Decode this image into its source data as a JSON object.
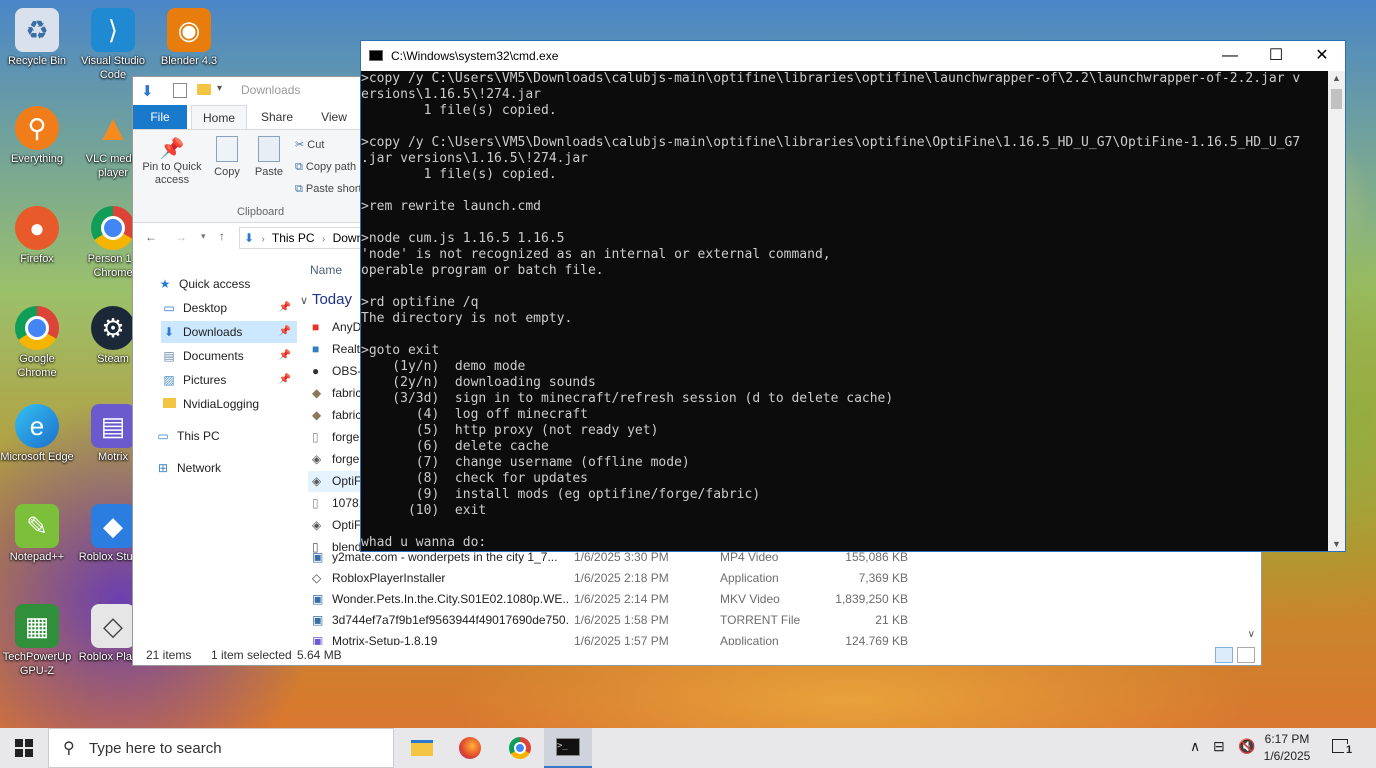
{
  "desktop": {
    "icons": [
      {
        "label": "Recycle Bin",
        "icon": "recycle-bin-icon",
        "color": "#cfd8e3"
      },
      {
        "label": "Visual Studio Code",
        "icon": "vscode-icon",
        "color": "#1f8ad2"
      },
      {
        "label": "Blender 4.3",
        "icon": "blender-icon",
        "color": "#e87d0d"
      },
      {
        "label": "Everything",
        "icon": "everything-icon",
        "color": "#f07c1a"
      },
      {
        "label": "VLC media player",
        "icon": "vlc-icon",
        "color": "#f58a1f"
      },
      {
        "label": "Firefox",
        "icon": "firefox-icon",
        "color": "#e85a2a"
      },
      {
        "label": "Person 1 - Chrome",
        "icon": "chrome-icon",
        "color": "#4285f4"
      },
      {
        "label": "Google Chrome",
        "icon": "chrome-icon",
        "color": "#4285f4"
      },
      {
        "label": "Steam",
        "icon": "steam-icon",
        "color": "#1b2838"
      },
      {
        "label": "Microsoft Edge",
        "icon": "edge-icon",
        "color": "#1f9ed8"
      },
      {
        "label": "Motrix",
        "icon": "motrix-icon",
        "color": "#6a5acd"
      },
      {
        "label": "Notepad++",
        "icon": "notepad-plus-plus-icon",
        "color": "#7bbf3a"
      },
      {
        "label": "Roblox Studio",
        "icon": "roblox-studio-icon",
        "color": "#2b7de0"
      },
      {
        "label": "TechPowerUp GPU-Z",
        "icon": "gpu-z-icon",
        "color": "#2f8f3a"
      },
      {
        "label": "Roblox Player",
        "icon": "roblox-icon",
        "color": "#444"
      }
    ]
  },
  "explorer": {
    "title": "Downloads",
    "tabs": [
      "File",
      "Home",
      "Share",
      "View"
    ],
    "ribbon": {
      "pin_label": "Pin to Quick access",
      "copy_label": "Copy",
      "paste_label": "Paste",
      "cut_label": "Cut",
      "copy_path_label": "Copy path",
      "paste_shortcut_label": "Paste shortcut",
      "group_label": "Clipboard"
    },
    "address": {
      "this_pc": "This PC",
      "downloads": "Downloads"
    },
    "nav": {
      "quick_access": "Quick access",
      "desktop": "Desktop",
      "downloads": "Downloads",
      "documents": "Documents",
      "pictures": "Pictures",
      "nvidia": "NvidiaLogging",
      "this_pc": "This PC",
      "network": "Network"
    },
    "column_name": "Name",
    "group_today": "Today",
    "files_hidden": [
      {
        "name": "AnyD"
      },
      {
        "name": "Realte"
      },
      {
        "name": "OBS-"
      },
      {
        "name": "fabric"
      },
      {
        "name": "fabric"
      },
      {
        "name": "forge"
      },
      {
        "name": "forge"
      },
      {
        "name": "OptiF"
      },
      {
        "name": "10781"
      },
      {
        "name": "OptiF"
      },
      {
        "name": "blend"
      }
    ],
    "files": [
      {
        "name": "y2mate.com - wonderpets in the city 1_7...",
        "date": "1/6/2025 3:30 PM",
        "type": "MP4 Video",
        "size": "155,086 KB"
      },
      {
        "name": "RobloxPlayerInstaller",
        "date": "1/6/2025 2:18 PM",
        "type": "Application",
        "size": "7,369 KB"
      },
      {
        "name": "Wonder.Pets.In.the.City.S01E02.1080p.WE...",
        "date": "1/6/2025 2:14 PM",
        "type": "MKV Video",
        "size": "1,839,250 KB"
      },
      {
        "name": "3d744ef7a7f9b1ef9563944f49017690de750...",
        "date": "1/6/2025 1:58 PM",
        "type": "TORRENT File",
        "size": "21 KB"
      },
      {
        "name": "Motrix-Setup-1.8.19",
        "date": "1/6/2025 1:57 PM",
        "type": "Application",
        "size": "124,769 KB"
      }
    ],
    "status": {
      "count": "21 items",
      "selected": "1 item selected",
      "size": "5.64 MB"
    }
  },
  "cmd": {
    "title": "C:\\Windows\\system32\\cmd.exe",
    "lines": [
      ">copy /y C:\\Users\\VM5\\Downloads\\calubjs-main\\optifine\\libraries\\optifine\\launchwrapper-of\\2.2\\launchwrapper-of-2.2.jar v",
      "ersions\\1.16.5\\!274.jar",
      "        1 file(s) copied.",
      "",
      ">copy /y C:\\Users\\VM5\\Downloads\\calubjs-main\\optifine\\libraries\\optifine\\OptiFine\\1.16.5_HD_U_G7\\OptiFine-1.16.5_HD_U_G7",
      ".jar versions\\1.16.5\\!274.jar",
      "        1 file(s) copied.",
      "",
      ">rem rewrite launch.cmd",
      "",
      ">node cum.js 1.16.5 1.16.5",
      "'node' is not recognized as an internal or external command,",
      "operable program or batch file.",
      "",
      ">rd optifine /q",
      "The directory is not empty.",
      "",
      ">goto exit",
      "    (1y/n)  demo mode",
      "    (2y/n)  downloading sounds",
      "    (3/3d)  sign in to minecraft/refresh session (d to delete cache)",
      "       (4)  log off minecraft",
      "       (5)  http proxy (not ready yet)",
      "       (6)  delete cache",
      "       (7)  change username (offline mode)",
      "       (8)  check for updates",
      "       (9)  install mods (eg optifine/forge/fabric)",
      "      (10)  exit",
      "",
      "whad u wanna do:"
    ]
  },
  "taskbar": {
    "search_placeholder": "Type here to search",
    "time": "6:17 PM",
    "date": "1/6/2025",
    "notification_count": "1"
  }
}
